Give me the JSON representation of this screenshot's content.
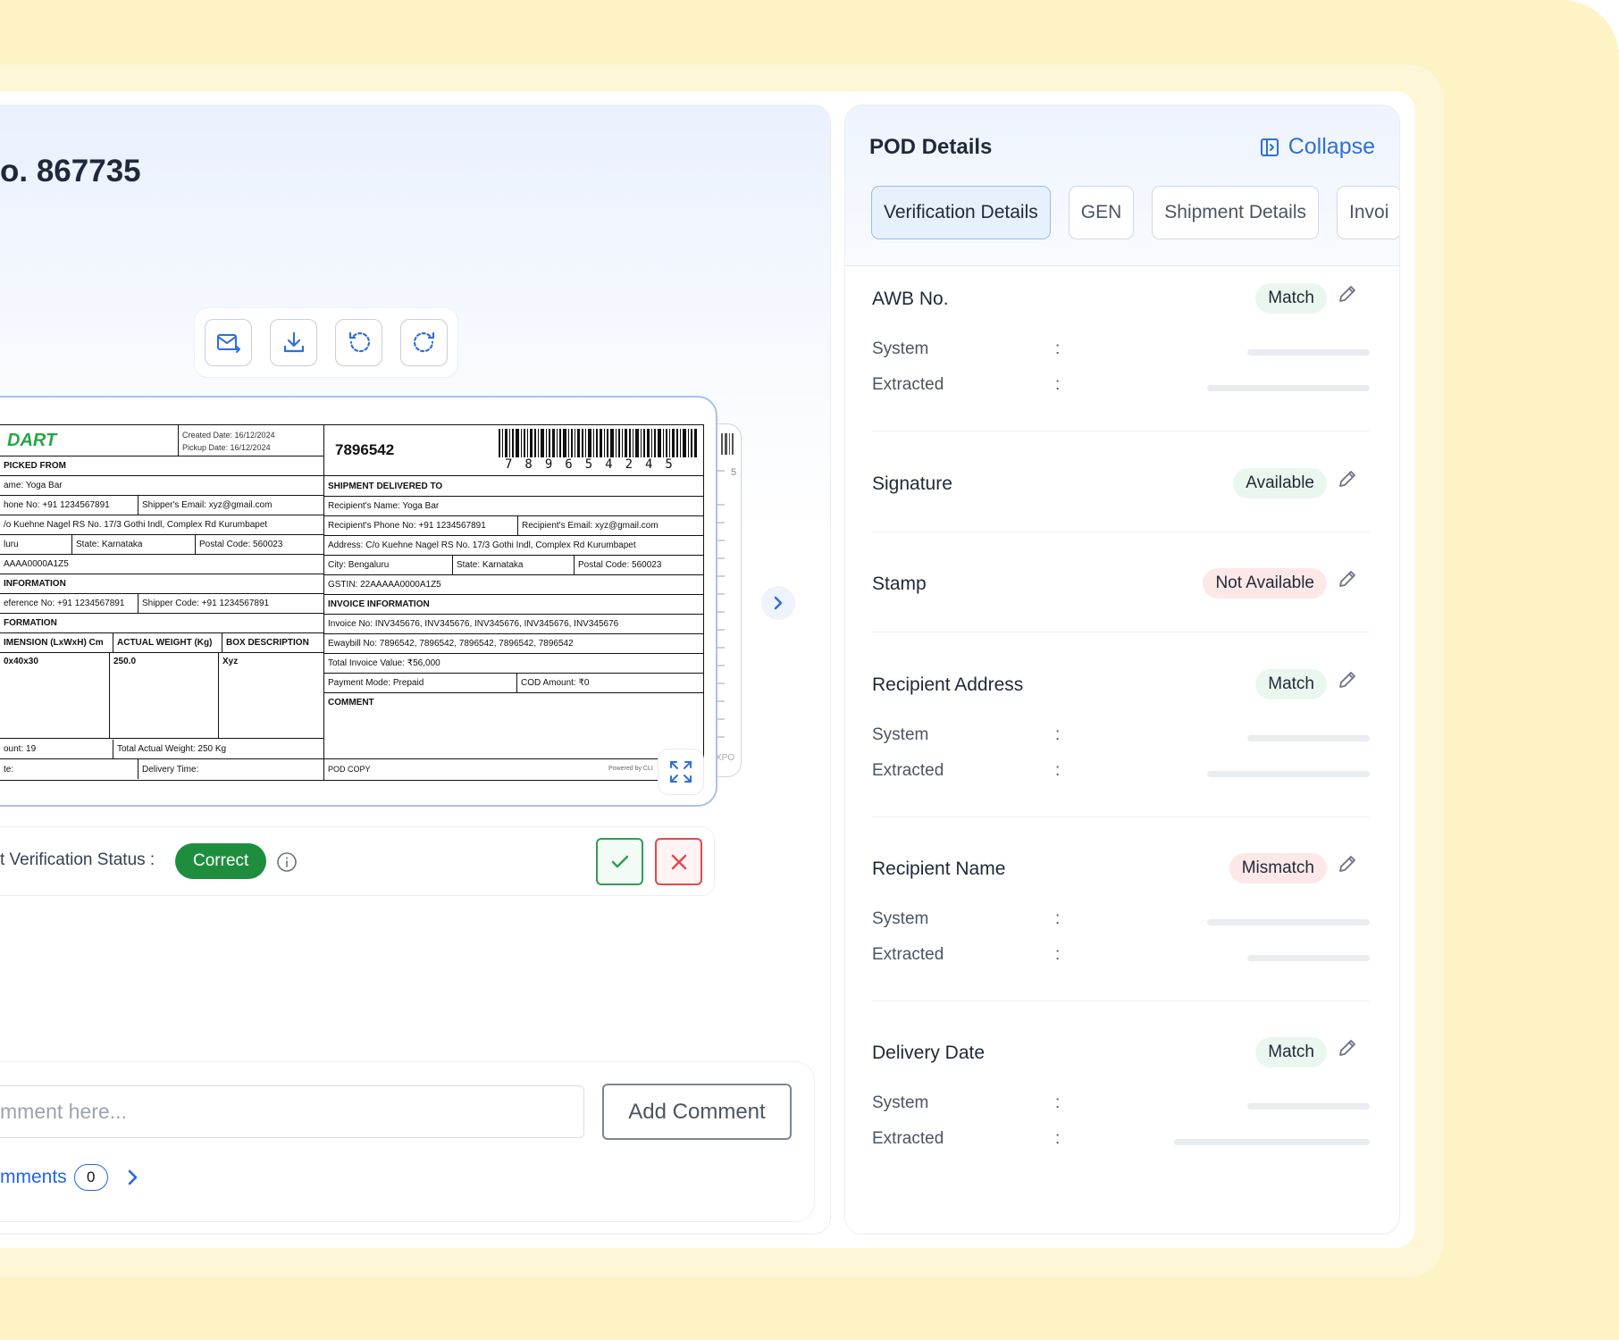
{
  "document": {
    "title": "o. 867735"
  },
  "toolbar": {
    "icons": [
      "mail-send-icon",
      "download-icon",
      "rotate-left-icon",
      "rotate-right-icon"
    ]
  },
  "label": {
    "brand": "DART",
    "created_date": "Created Date: 16/12/2024",
    "pickup_date": "Pickup Date: 16/12/2024",
    "awb": "7896542",
    "barcode_digits": "789654245",
    "left_rows": [
      "PICKED FROM",
      "ame:  Yoga Bar",
      "hone No:  +91 1234567891",
      "/o Kuehne Nagel RS  No. 17/3 Gothi Indl, Complex Rd Kurumbapet",
      "luru",
      "AAAA0000A1Z5",
      "INFORMATION",
      "eference No:  +91 1234567891",
      "FORMATION",
      "IMENSION (LxWxH) Cm",
      "0x40x30",
      "ount:  19",
      "te:"
    ],
    "shipper_email": "Shipper's Email:  xyz@gmail.com",
    "state": "State:  Karnataka",
    "postal": "Postal Code:  560023",
    "shipper_code": "Shipper Code:  +91 1234567891",
    "actual_weight": "ACTUAL WEIGHT (Kg)",
    "box_desc": "BOX DESCRIPTION",
    "weight_val": "250.0",
    "box_val": "Xyz",
    "total_weight": "Total Actual Weight:  250 Kg",
    "delivery_time": "Delivery Time:",
    "right_rows": [
      "SHIPMENT DELIVERED TO",
      "Recipient's Name:  Yoga Bar",
      "Recipient's Phone No:  +91 1234567891",
      "Address:  C/o Kuehne Nagel RS  No. 17/3 Gothi Indl, Complex Rd Kurumbapet",
      "City:  Bengaluru",
      "GSTIN:  22AAAAA0000A1Z5",
      "INVOICE INFORMATION",
      "Invoice No:  INV345676, INV345676, INV345676, INV345676, INV345676",
      "Ewaybill No:  7896542, 7896542, 7896542, 7896542, 7896542",
      "Total Invoice Value:  ₹56,000",
      "Payment Mode:  Prepaid",
      "COMMENT"
    ],
    "recipient_email": "Recipient's Email:  xyz@gmail.com",
    "r_state": "State:  Karnataka",
    "r_postal": "Postal Code:  560023",
    "cod": "COD Amount:  ₹0",
    "pod_copy": "POD COPY",
    "powered_by": "Powered by  CLI",
    "back_text_1": "5",
    "back_text_2": "XPO"
  },
  "verification": {
    "label": "t Verification Status :",
    "status": "Correct"
  },
  "comment": {
    "placeholder": "mment here...",
    "add_label": "Add Comment",
    "link_label": "mments",
    "count": "0"
  },
  "pod": {
    "title": "POD Details",
    "collapse_label": "Collapse",
    "tabs": [
      {
        "label": "Verification Details",
        "active": true
      },
      {
        "label": "GEN",
        "active": false
      },
      {
        "label": "Shipment Details",
        "active": false
      },
      {
        "label": "Invoi",
        "active": false
      }
    ],
    "system_label": "System",
    "extracted_label": "Extracted",
    "colon": ":",
    "fields": [
      {
        "title": "AWB No.",
        "status": "Match",
        "tone": "green"
      },
      {
        "title": "Signature",
        "status": "Available",
        "tone": "green"
      },
      {
        "title": "Stamp",
        "status": "Not Available",
        "tone": "red"
      },
      {
        "title": "Recipient Address",
        "status": "Match",
        "tone": "green"
      },
      {
        "title": "Recipient Name",
        "status": "Mismatch",
        "tone": "red"
      },
      {
        "title": "Delivery Date",
        "status": "Match",
        "tone": "green"
      }
    ]
  },
  "colors": {
    "accent": "#2f6fd6",
    "success": "#1e8e3e",
    "danger": "#e04b4b",
    "brand_green": "#27a745"
  }
}
